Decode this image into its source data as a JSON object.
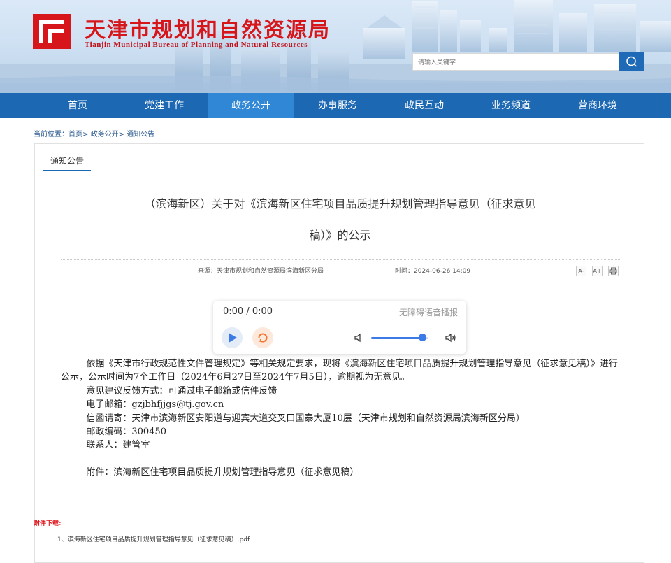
{
  "header": {
    "title": "天津市规划和自然资源局",
    "subtitle": "Tianjin Municipal Bureau of Planning and Natural Resources",
    "search_placeholder": "请输入关键字"
  },
  "nav": [
    {
      "label": "首页"
    },
    {
      "label": "党建工作"
    },
    {
      "label": "政务公开",
      "active": true
    },
    {
      "label": "办事服务"
    },
    {
      "label": "政民互动"
    },
    {
      "label": "业务频道"
    },
    {
      "label": "营商环境"
    }
  ],
  "breadcrumb": {
    "prefix": "当前位置：",
    "items": [
      "首页",
      "政务公开",
      "通知公告"
    ],
    "sep": ">"
  },
  "tab": {
    "label": "通知公告"
  },
  "article": {
    "title_line1": "（滨海新区）关于对《滨海新区住宅项目品质提升规划管理指导意见（征求意见",
    "title_line2": "稿）》的公示",
    "source": "来源：天津市规划和自然资源局滨海新区分局",
    "time": "时间：2024-06-26 14:09",
    "font_buttons": [
      "A-",
      "A+"
    ],
    "print_icon": "printer-icon",
    "paragraphs": [
      "依据《天津市行政规范性文件管理规定》等相关规定要求，现将《滨海新区住宅项目品质提升规划管理指导意见（征求意见稿）》进行公示，公示时间为7个工作日（2024年6月27日至2024年7月5日），逾期视为无意见。",
      "意见建议反馈方式：可通过电子邮箱或信件反馈",
      "电子邮箱：gzjbhfjjgs@tj.gov.cn",
      "信函请寄：天津市滨海新区安阳道与迎宾大道交叉口国泰大厦10层（天津市规划和自然资源局滨海新区分局）",
      "邮政编码：300450",
      "联系人：建管室",
      "",
      "附件：滨海新区住宅项目品质提升规划管理指导意见（征求意见稿）"
    ]
  },
  "player": {
    "time": "0:00 / 0:00",
    "label": "无障碍语音播报",
    "volume_fraction": 0.9,
    "accent": "#3c7be6"
  },
  "attachments": {
    "title": "附件下载:",
    "items": [
      {
        "index": "1、",
        "name": "滨海新区住宅项目品质提升规划管理指导意见（征求意见稿）.pdf"
      }
    ]
  },
  "colors": {
    "nav_bg": "#1d68b3",
    "nav_active": "#2f87d5",
    "brand_red": "#d7161c"
  }
}
